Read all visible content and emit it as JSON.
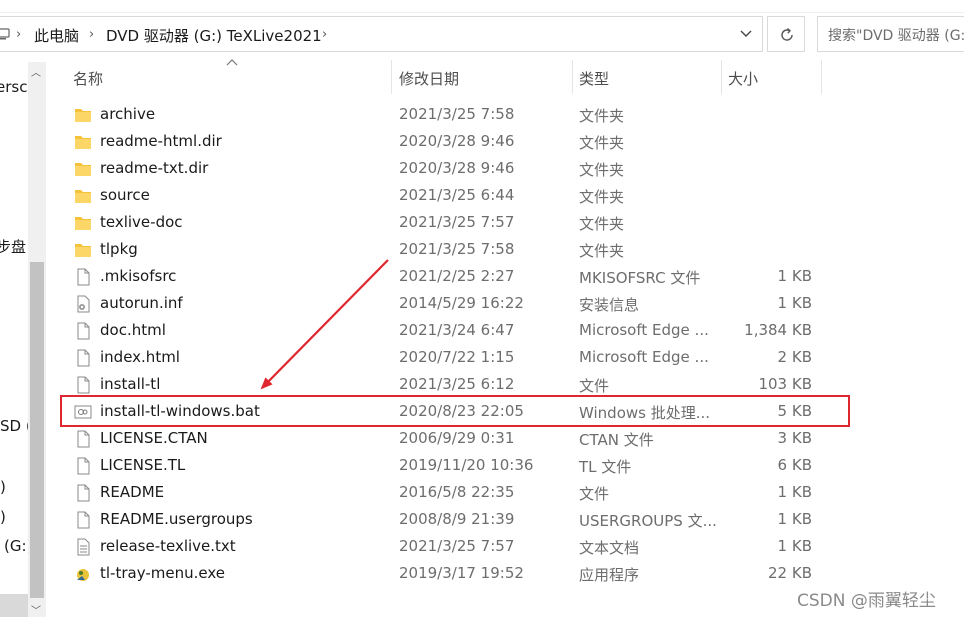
{
  "address": {
    "crumbs": [
      "此电脑",
      "DVD 驱动器 (G:) TeXLive2021"
    ],
    "separator": "›"
  },
  "search": {
    "placeholder": "搜索\"DVD 驱动器 (G:"
  },
  "nav": {
    "items": [
      "ersc",
      "步盘",
      "SD (",
      ")",
      ")",
      "(G:)"
    ]
  },
  "columns": {
    "name": "名称",
    "date": "修改日期",
    "type": "类型",
    "size": "大小"
  },
  "files": [
    {
      "name": "archive",
      "date": "2021/3/25 7:58",
      "type": "文件夹",
      "size": "",
      "icon": "folder-icon"
    },
    {
      "name": "readme-html.dir",
      "date": "2020/3/28 9:46",
      "type": "文件夹",
      "size": "",
      "icon": "folder-icon"
    },
    {
      "name": "readme-txt.dir",
      "date": "2020/3/28 9:46",
      "type": "文件夹",
      "size": "",
      "icon": "folder-icon"
    },
    {
      "name": "source",
      "date": "2021/3/25 6:44",
      "type": "文件夹",
      "size": "",
      "icon": "folder-icon"
    },
    {
      "name": "texlive-doc",
      "date": "2021/3/25 7:57",
      "type": "文件夹",
      "size": "",
      "icon": "folder-icon"
    },
    {
      "name": "tlpkg",
      "date": "2021/3/25 7:58",
      "type": "文件夹",
      "size": "",
      "icon": "folder-icon"
    },
    {
      "name": ".mkisofsrc",
      "date": "2021/2/25 2:27",
      "type": "MKISOFSRC 文件",
      "size": "1 KB",
      "icon": "file-icon"
    },
    {
      "name": "autorun.inf",
      "date": "2014/5/29 16:22",
      "type": "安装信息",
      "size": "1 KB",
      "icon": "settings-file-icon"
    },
    {
      "name": "doc.html",
      "date": "2021/3/24 6:47",
      "type": "Microsoft Edge ...",
      "size": "1,384 KB",
      "icon": "file-icon"
    },
    {
      "name": "index.html",
      "date": "2020/7/22 1:15",
      "type": "Microsoft Edge ...",
      "size": "2 KB",
      "icon": "file-icon"
    },
    {
      "name": "install-tl",
      "date": "2021/3/25 6:12",
      "type": "文件",
      "size": "103 KB",
      "icon": "file-icon"
    },
    {
      "name": "install-tl-windows.bat",
      "date": "2020/8/23 22:05",
      "type": "Windows 批处理...",
      "size": "5 KB",
      "icon": "batch-file-icon"
    },
    {
      "name": "LICENSE.CTAN",
      "date": "2006/9/29 0:31",
      "type": "CTAN 文件",
      "size": "3 KB",
      "icon": "file-icon"
    },
    {
      "name": "LICENSE.TL",
      "date": "2019/11/20 10:36",
      "type": "TL 文件",
      "size": "6 KB",
      "icon": "file-icon"
    },
    {
      "name": "README",
      "date": "2016/5/8 22:35",
      "type": "文件",
      "size": "1 KB",
      "icon": "file-icon"
    },
    {
      "name": "README.usergroups",
      "date": "2008/8/9 21:39",
      "type": "USERGROUPS 文...",
      "size": "1 KB",
      "icon": "file-icon"
    },
    {
      "name": "release-texlive.txt",
      "date": "2021/3/25 7:57",
      "type": "文本文档",
      "size": "1 KB",
      "icon": "text-file-icon"
    },
    {
      "name": "tl-tray-menu.exe",
      "date": "2019/3/17 19:52",
      "type": "应用程序",
      "size": "22 KB",
      "icon": "app-icon"
    }
  ],
  "annotation": {
    "highlighted_file": "install-tl-windows.bat",
    "color": "#e0262e"
  },
  "watermark": "CSDN @雨翼轻尘",
  "colors": {
    "folder": "#f5c33b",
    "muted_text": "#6d6d6d"
  }
}
